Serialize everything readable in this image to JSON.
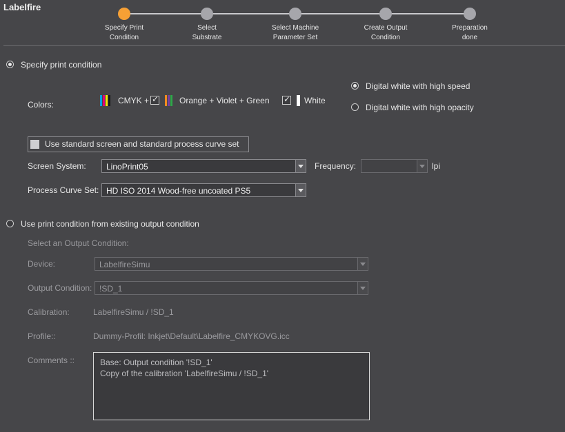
{
  "app": {
    "title": "Labelfire"
  },
  "wizard": {
    "steps": [
      {
        "label_line1": "Specify Print",
        "label_line2": "Condition",
        "active": true
      },
      {
        "label_line1": "Select",
        "label_line2": "Substrate",
        "active": false
      },
      {
        "label_line1": "Select Machine",
        "label_line2": "Parameter Set",
        "active": false
      },
      {
        "label_line1": "Create Output",
        "label_line2": "Condition",
        "active": false
      },
      {
        "label_line1": "Preparation",
        "label_line2": "done",
        "active": false
      }
    ]
  },
  "specify": {
    "radio_label": "Specify print condition",
    "selected": true,
    "colors_label": "Colors:",
    "cmyk_label": "CMYK +",
    "orange_violet_green_label": "Orange + Violet + Green",
    "white_label": "White",
    "ovg_checked": true,
    "white_checked": true,
    "white_mode_options": [
      "Digital white with high speed",
      "Digital white with high opacity"
    ],
    "white_mode_selected": "Digital white with high speed",
    "use_standard_label": "Use standard screen and standard process curve set",
    "screen_system_label": "Screen System:",
    "screen_system_value": "LinoPrint05",
    "frequency_label": "Frequency:",
    "frequency_value": "",
    "frequency_unit": "lpi",
    "process_curve_label": "Process Curve Set:",
    "process_curve_value": "HD ISO 2014 Wood-free uncoated PS5"
  },
  "existing": {
    "radio_label": "Use print condition from existing output condition",
    "selected": false,
    "select_heading": "Select an Output Condition:",
    "device_label": "Device:",
    "device_value": "LabelfireSimu",
    "output_condition_label": "Output Condition:",
    "output_condition_value": "!SD_1",
    "calibration_label": "Calibration:",
    "calibration_value": "LabelfireSimu / !SD_1",
    "profile_label": "Profile::",
    "profile_value": "Dummy-Profil: Inkjet\\Default\\Labelfire_CMYKOVG.icc",
    "comments_label": "Comments ::",
    "comments_lines": [
      "Base: Output condition '!SD_1'",
      "Copy of the calibration 'LabelfireSimu / !SD_1'"
    ]
  },
  "colors": {
    "accent": "#f6a035",
    "background": "#464649",
    "cmyk_bars": [
      "#00a0e0",
      "#e0007a",
      "#f5e100",
      "#1a1a1a"
    ],
    "ovg_bars": [
      "#f28c1e",
      "#7a3fa0",
      "#2ea84a"
    ]
  }
}
